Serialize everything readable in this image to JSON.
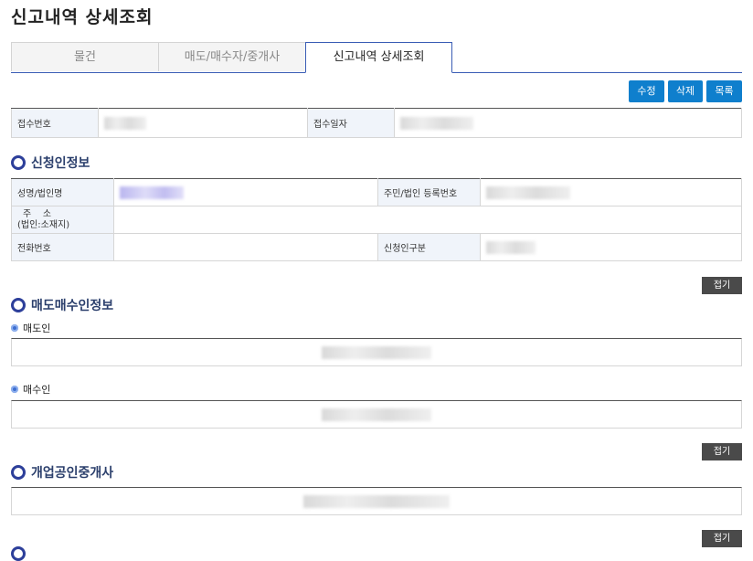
{
  "page": {
    "title": "신고내역 상세조회"
  },
  "tabs": [
    {
      "label": "물건"
    },
    {
      "label": "매도/매수자/중개사"
    },
    {
      "label": "신고내역 상세조회"
    }
  ],
  "actions": {
    "edit": "수정",
    "delete": "삭제",
    "list": "목록"
  },
  "receipt": {
    "number_label": "접수번호",
    "date_label": "접수일자"
  },
  "applicant": {
    "section_title": "신청인정보",
    "name_label": "성명/법인명",
    "regno_label": "주민/법인 등록번호",
    "address_label_1": "주    소",
    "address_label_2": "(법인:소재지)",
    "phone_label": "전화번호",
    "type_label": "신청인구분",
    "collapse": "접기"
  },
  "trade": {
    "section_title": "매도매수인정보",
    "seller_label": "매도인",
    "buyer_label": "매수인",
    "collapse": "접기"
  },
  "broker": {
    "section_title": "개업공인중개사",
    "collapse": "접기"
  }
}
